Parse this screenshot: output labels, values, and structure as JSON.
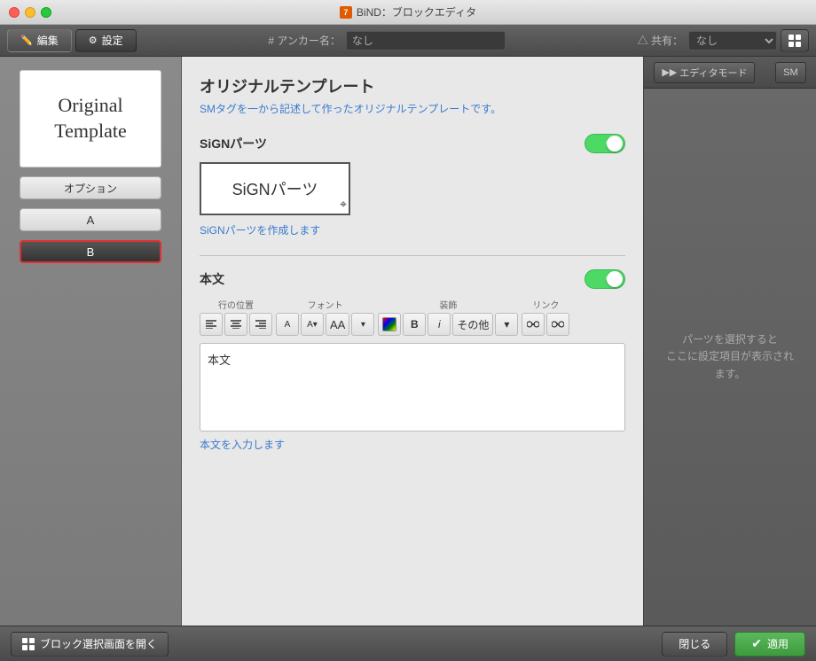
{
  "window": {
    "title": "BiND：ブロックエディタ",
    "title_icon": "7"
  },
  "top_toolbar": {
    "edit_btn": "編集",
    "settings_btn": "設定",
    "anchor_label": "# アンカー名：",
    "anchor_value": "なし",
    "share_label": "△ 共有：",
    "share_value": "なし"
  },
  "left_sidebar": {
    "template_line1": "Original",
    "template_line2": "Template",
    "option_btn": "オプション",
    "tab_a": "A",
    "tab_b": "B"
  },
  "center_panel": {
    "title": "オリジナルテンプレート",
    "subtitle": "SMタグを一から記述して作ったオリジナルテンプレートです。",
    "sign_section": {
      "title": "SiGNパーツ",
      "toggle_label": "ON",
      "preview_text": "SiGNパーツ",
      "link_text": "SiGNパーツを作成します"
    },
    "text_section": {
      "title": "本文",
      "toggle_label": "ON",
      "row_label": "行の位置",
      "font_label": "フォント",
      "decoration_label": "装飾",
      "link_label": "リンク",
      "bold_btn": "B",
      "italic_btn": "i",
      "other_btn": "その他",
      "body_text": "本文",
      "link_text": "本文を入力します"
    }
  },
  "right_sidebar": {
    "editor_mode_btn": "エディタモード",
    "sm_btn": "SM",
    "info_text": "パーツを選択すると\nここに設定項目が表示されます。"
  },
  "bottom_bar": {
    "open_block_btn": "ブロック選択画面を開く",
    "close_btn": "閉じる",
    "apply_btn": "適用"
  }
}
